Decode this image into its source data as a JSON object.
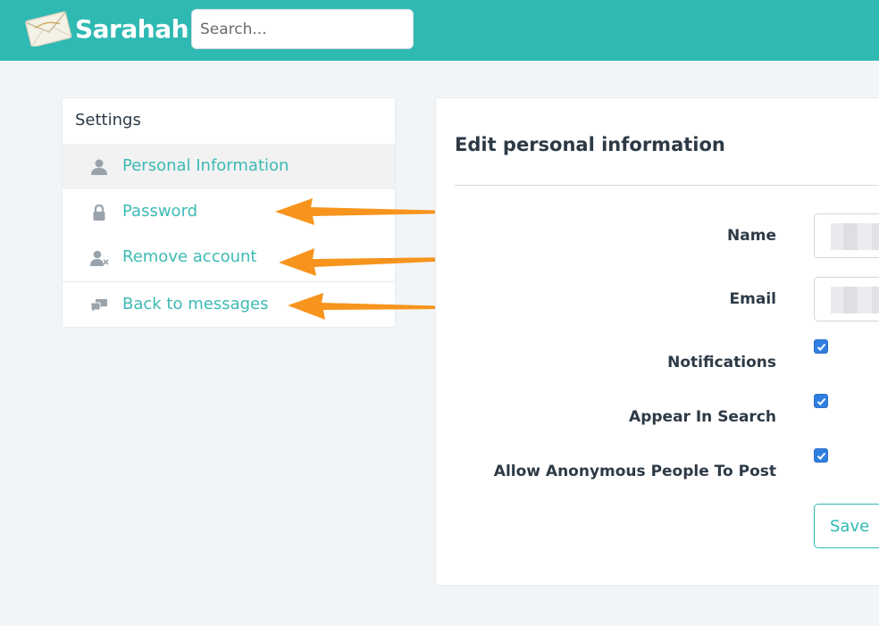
{
  "header": {
    "brand": "Sarahah",
    "logo_icon": "envelope-icon",
    "search_placeholder": "Search...",
    "bar_color": "#2fb9b3"
  },
  "sidebar": {
    "title": "Settings",
    "items": [
      {
        "label": "Personal Information",
        "icon": "user-icon",
        "active": true
      },
      {
        "label": "Password",
        "icon": "lock-icon",
        "active": false
      },
      {
        "label": "Remove account",
        "icon": "user-remove-icon",
        "active": false
      },
      {
        "label": "Back to messages",
        "icon": "chat-bubbles-icon",
        "active": false
      }
    ],
    "link_color": "#3dbab4"
  },
  "annotations": {
    "arrow_color": "#f7941d",
    "arrows": [
      "arrow-to-password",
      "arrow-to-remove-account",
      "arrow-to-back-to-messages"
    ]
  },
  "main": {
    "title": "Edit personal information",
    "fields": {
      "name_label": "Name",
      "email_label": "Email",
      "notifications_label": "Notifications",
      "appear_in_search_label": "Appear In Search",
      "allow_anonymous_label": "Allow Anonymous People To Post"
    },
    "checkboxes": {
      "notifications": true,
      "appear_in_search": true,
      "allow_anonymous": true
    },
    "save_label": "Save",
    "checkbox_color": "#2f7fe0"
  }
}
